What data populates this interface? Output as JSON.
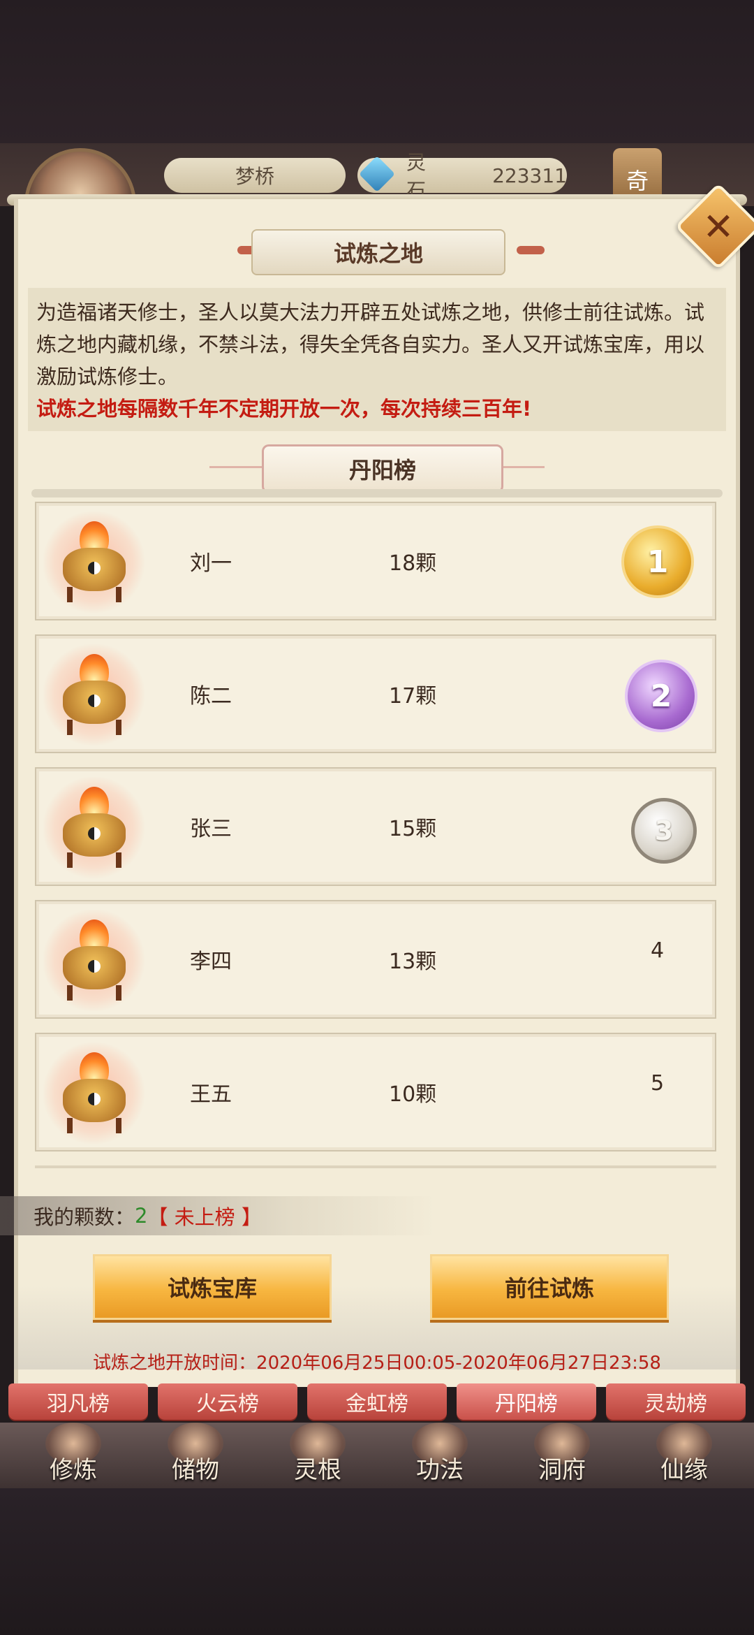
{
  "header": {
    "player_name": "梦桥",
    "currency_label": "灵石",
    "currency_value": "223311",
    "right_icon_label": "奇"
  },
  "panel": {
    "title": "试炼之地",
    "description": "为造福诸天修士，圣人以莫大法力开辟五处试炼之地，供修士前往试炼。试炼之地内藏机缘，不禁斗法，得失全凭各自实力。圣人又开试炼宝库，用以激励试炼修士。",
    "notice": "试炼之地每隔数千年不定期开放一次，每次持续三百年!",
    "leaderboard_title": "丹阳榜",
    "rows": [
      {
        "name": "刘一",
        "count": "18颗",
        "rank": "1",
        "medal": "gold"
      },
      {
        "name": "陈二",
        "count": "17颗",
        "rank": "2",
        "medal": "purple"
      },
      {
        "name": "张三",
        "count": "15颗",
        "rank": "3",
        "medal": "silver"
      },
      {
        "name": "李四",
        "count": "13颗",
        "rank": "4",
        "medal": "none"
      },
      {
        "name": "王五",
        "count": "10颗",
        "rank": "5",
        "medal": "none"
      }
    ],
    "my_count_label": "我的颗数：",
    "my_count_value": "2",
    "my_count_status": "【 未上榜 】",
    "btn_treasury": "试炼宝库",
    "btn_go": "前往试炼",
    "open_time": "试炼之地开放时间：2020年06月25日00:05-2020年06月27日23:58"
  },
  "tabs": [
    "羽凡榜",
    "火云榜",
    "金虹榜",
    "丹阳榜",
    "灵劫榜"
  ],
  "active_tab": "丹阳榜",
  "nav": [
    "修炼",
    "储物",
    "灵根",
    "功法",
    "洞府",
    "仙缘"
  ],
  "colors": {
    "panel_bg": "#f3ecd8",
    "notice_red": "#c41c12",
    "button_gold": "#f7b640",
    "tab_red": "#b8433b"
  }
}
